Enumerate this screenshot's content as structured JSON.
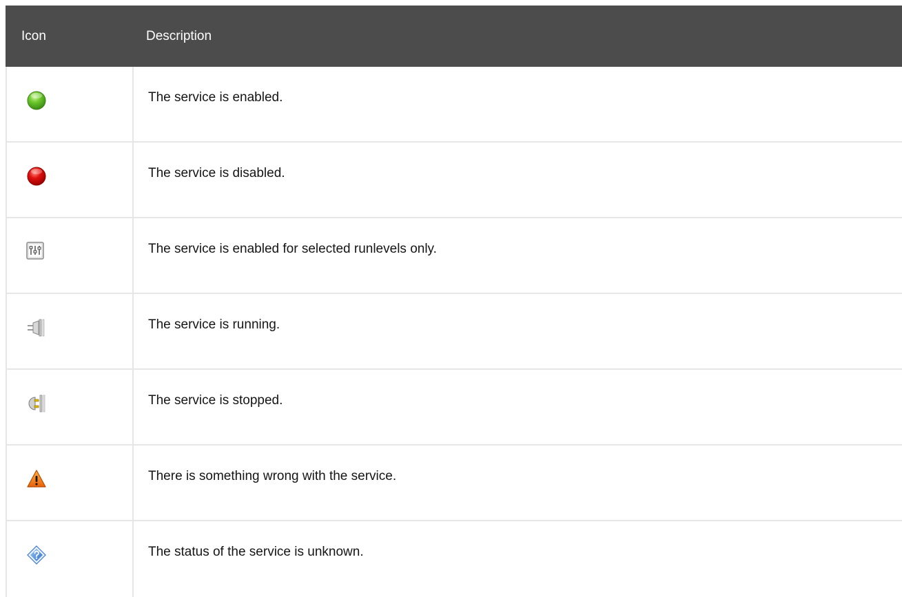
{
  "table": {
    "headers": {
      "icon": "Icon",
      "description": "Description"
    },
    "rows": [
      {
        "icon": "green-circle-icon",
        "description": "The service is enabled."
      },
      {
        "icon": "red-circle-icon",
        "description": "The service is disabled."
      },
      {
        "icon": "runlevels-icon",
        "description": "The service is enabled for selected runlevels only."
      },
      {
        "icon": "plug-connected-icon",
        "description": "The service is running."
      },
      {
        "icon": "plug-disconnected-icon",
        "description": "The service is stopped."
      },
      {
        "icon": "warning-triangle-icon",
        "description": "There is something wrong with the service."
      },
      {
        "icon": "unknown-diamond-icon",
        "description": "The status of the service is unknown."
      }
    ]
  },
  "colors": {
    "header_bg": "#4c4c4c",
    "header_text": "#ffffff",
    "border": "#e6e6e6",
    "text": "#151515"
  }
}
